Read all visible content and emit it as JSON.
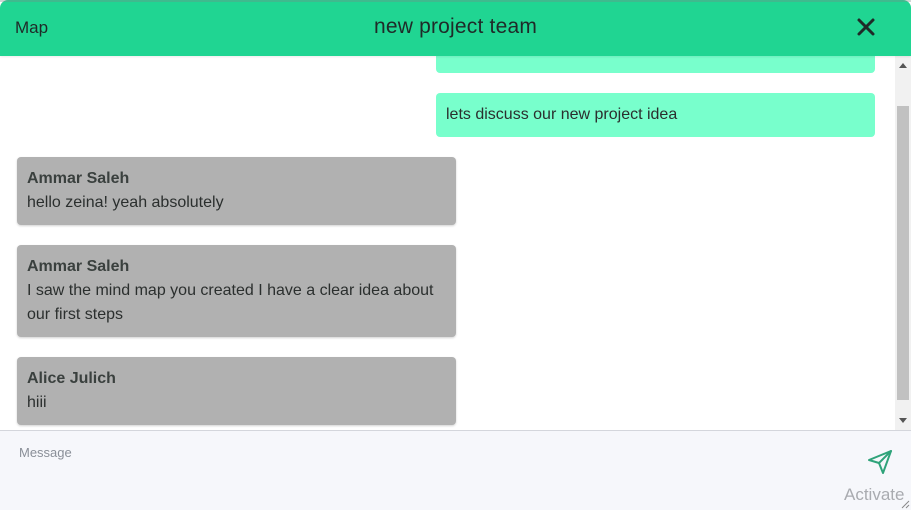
{
  "header": {
    "map_label": "Map",
    "title": "new project team",
    "close_icon": "close-icon"
  },
  "colors": {
    "header_bg": "#20d592",
    "own_bubble": "#78ffcc",
    "other_bubble": "#b1b1b1"
  },
  "messages": [
    {
      "own": true,
      "text": "lets discuss our new project idea"
    },
    {
      "own": false,
      "sender": "Ammar Saleh",
      "text": "hello zeina! yeah absolutely"
    },
    {
      "own": false,
      "sender": "Ammar Saleh",
      "text": "I saw the mind map you created I have a clear idea about our first steps"
    },
    {
      "own": false,
      "sender": "Alice Julich",
      "text": "hiii"
    }
  ],
  "compose": {
    "placeholder": "Message",
    "value": "",
    "send_icon": "send-icon"
  },
  "watermark": "Activate"
}
